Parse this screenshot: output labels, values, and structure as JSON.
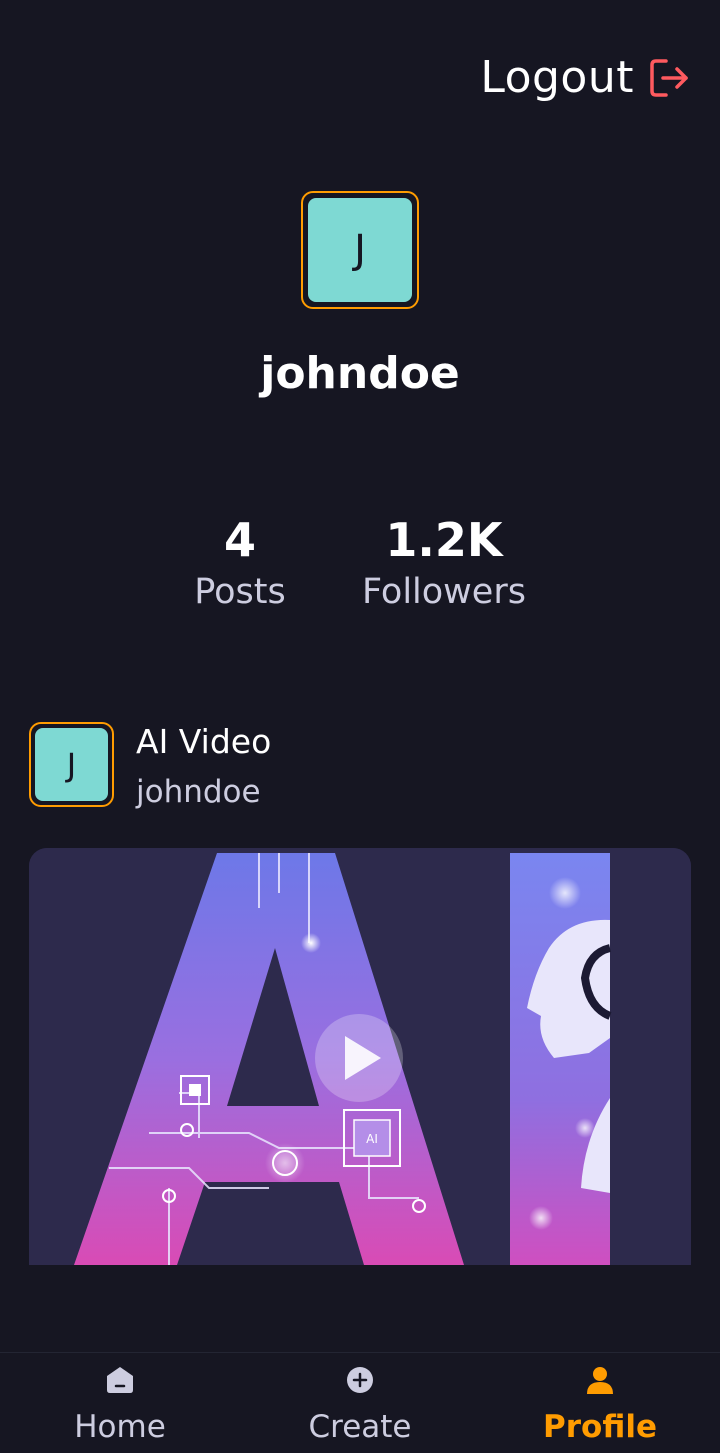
{
  "header": {
    "logout_label": "Logout"
  },
  "profile": {
    "avatar_initial": "J",
    "username": "johndoe",
    "stats": {
      "posts_value": "4",
      "posts_label": "Posts",
      "followers_value": "1.2K",
      "followers_label": "Followers"
    }
  },
  "post": {
    "avatar_initial": "J",
    "title": "AI Video",
    "creator": "johndoe",
    "thumbnail_text": "AI"
  },
  "tabs": [
    {
      "label": "Home",
      "icon": "home-icon"
    },
    {
      "label": "Create",
      "icon": "plus-icon"
    },
    {
      "label": "Profile",
      "icon": "profile-icon",
      "active": true
    }
  ],
  "colors": {
    "background": "#161622",
    "accent": "#ff9c01",
    "avatar_bg": "#7ed9d3",
    "logout_icon": "#ff5a5f",
    "secondary_text": "#cdcde0"
  }
}
